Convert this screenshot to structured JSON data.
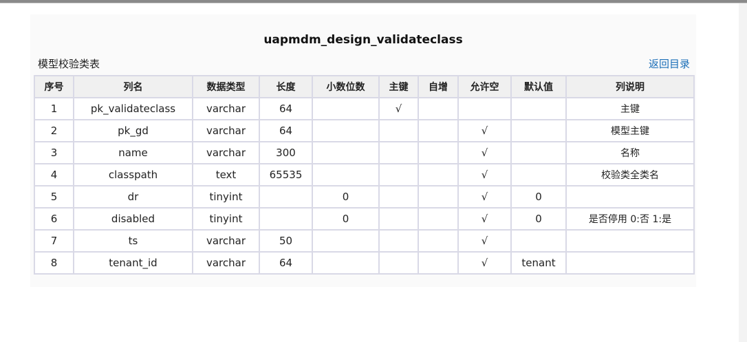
{
  "title": "uapmdm_design_validateclass",
  "subtitle": "模型校验类表",
  "back_link": "返回目录",
  "columns": [
    "序号",
    "列名",
    "数据类型",
    "长度",
    "小数位数",
    "主键",
    "自增",
    "允许空",
    "默认值",
    "列说明"
  ],
  "rows": [
    [
      "1",
      "pk_validateclass",
      "varchar",
      "64",
      "",
      "√",
      "",
      "",
      "",
      "主键"
    ],
    [
      "2",
      "pk_gd",
      "varchar",
      "64",
      "",
      "",
      "",
      "√",
      "",
      "模型主键"
    ],
    [
      "3",
      "name",
      "varchar",
      "300",
      "",
      "",
      "",
      "√",
      "",
      "名称"
    ],
    [
      "4",
      "classpath",
      "text",
      "65535",
      "",
      "",
      "",
      "√",
      "",
      "校验类全类名"
    ],
    [
      "5",
      "dr",
      "tinyint",
      "",
      "0",
      "",
      "",
      "√",
      "0",
      ""
    ],
    [
      "6",
      "disabled",
      "tinyint",
      "",
      "0",
      "",
      "",
      "√",
      "0",
      "是否停用 0:否 1:是"
    ],
    [
      "7",
      "ts",
      "varchar",
      "50",
      "",
      "",
      "",
      "√",
      "",
      ""
    ],
    [
      "8",
      "tenant_id",
      "varchar",
      "64",
      "",
      "",
      "",
      "√",
      "tenant",
      ""
    ]
  ]
}
